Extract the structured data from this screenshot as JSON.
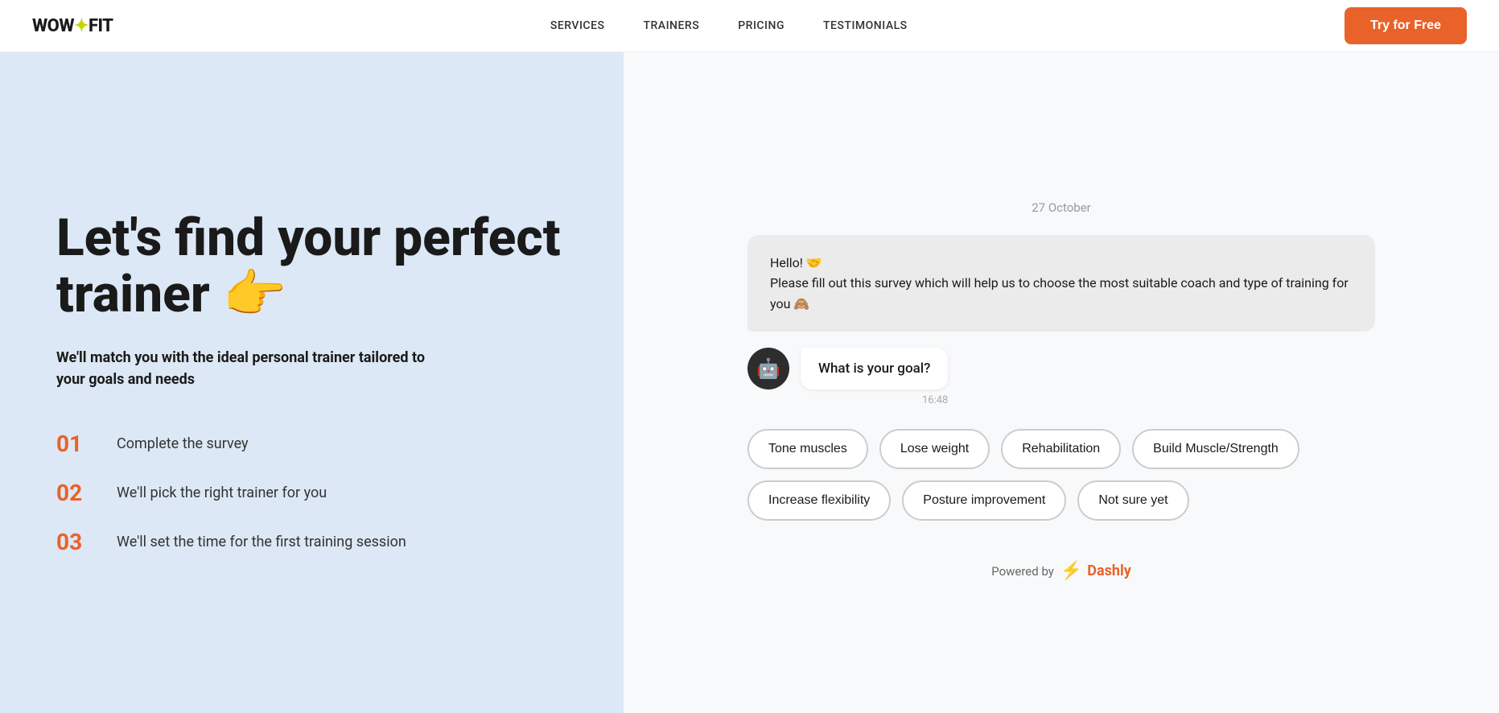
{
  "header": {
    "logo": {
      "wow": "WOW",
      "dot": "✦",
      "fit": "FIT"
    },
    "nav": [
      {
        "label": "SERVICES",
        "href": "#"
      },
      {
        "label": "TRAINERS",
        "href": "#"
      },
      {
        "label": "PRICING",
        "href": "#"
      },
      {
        "label": "TESTIMONIALS",
        "href": "#"
      }
    ],
    "cta_label": "Try for Free"
  },
  "left": {
    "title": "Let's find your perfect trainer 👉",
    "subtitle": "We'll match you with the ideal personal trainer tailored to your goals and needs",
    "steps": [
      {
        "num": "01",
        "text": "Complete the survey"
      },
      {
        "num": "02",
        "text": "We'll pick the right trainer for you"
      },
      {
        "num": "03",
        "text": "We'll set the time for the first training session"
      }
    ]
  },
  "chat": {
    "date": "27 October",
    "greeting": "Hello! 🤝\nPlease fill out this survey which will help us to choose the most suitable coach and type of training for you 🙈",
    "question": "What is your goal?",
    "time": "16:48",
    "options": [
      "Tone muscles",
      "Lose weight",
      "Rehabilitation",
      "Build Muscle/Strength",
      "Increase flexibility",
      "Posture improvement",
      "Not sure yet"
    ],
    "powered_by": "Powered by",
    "powered_brand": "Dashly"
  }
}
